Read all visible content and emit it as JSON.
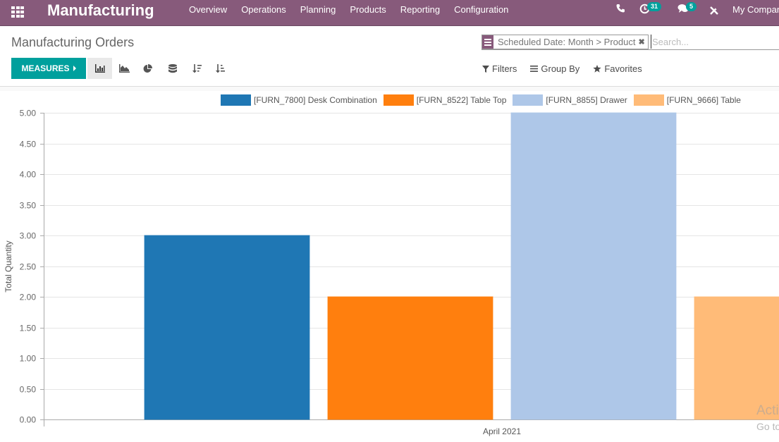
{
  "navbar": {
    "app_name": "Manufacturing",
    "menu": [
      "Overview",
      "Operations",
      "Planning",
      "Products",
      "Reporting",
      "Configuration"
    ],
    "activity_count": "31",
    "messages_count": "5",
    "company": "My Company"
  },
  "control_panel": {
    "title": "Manufacturing Orders",
    "facet_label": "Scheduled Date: Month > Product",
    "search_placeholder": "Search...",
    "measures_label": "MEASURES",
    "filters_label": "Filters",
    "groupby_label": "Group By",
    "favorites_label": "Favorites",
    "tools": [
      "bar-chart",
      "line-chart",
      "pie-chart",
      "stacked",
      "descending",
      "ascending"
    ],
    "active_tool": "bar-chart"
  },
  "colors": {
    "brand": "#875A7B",
    "accent": "#00A09D"
  },
  "watermark": {
    "line1": "Activate Windows",
    "line2": "Go to Settings to activate Windows."
  },
  "chart_data": {
    "type": "bar",
    "title": "",
    "categories": [
      "April 2021"
    ],
    "series": [
      {
        "name": "[FURN_7800] Desk Combination",
        "values": [
          3
        ],
        "color": "#1f77b4"
      },
      {
        "name": "[FURN_8522] Table Top",
        "values": [
          2
        ],
        "color": "#ff7f0e"
      },
      {
        "name": "[FURN_8855] Drawer",
        "values": [
          5
        ],
        "color": "#aec7e8"
      },
      {
        "name": "[FURN_9666] Table",
        "values": [
          2
        ],
        "color": "#ffbb78"
      }
    ],
    "xlabel": "",
    "ylabel": "Total Quantity",
    "ylim": [
      0,
      5
    ],
    "yticks": [
      "0.00",
      "0.50",
      "1.00",
      "1.50",
      "2.00",
      "2.50",
      "3.00",
      "3.50",
      "4.00",
      "4.50",
      "5.00"
    ],
    "grid": true,
    "legend_position": "top"
  }
}
